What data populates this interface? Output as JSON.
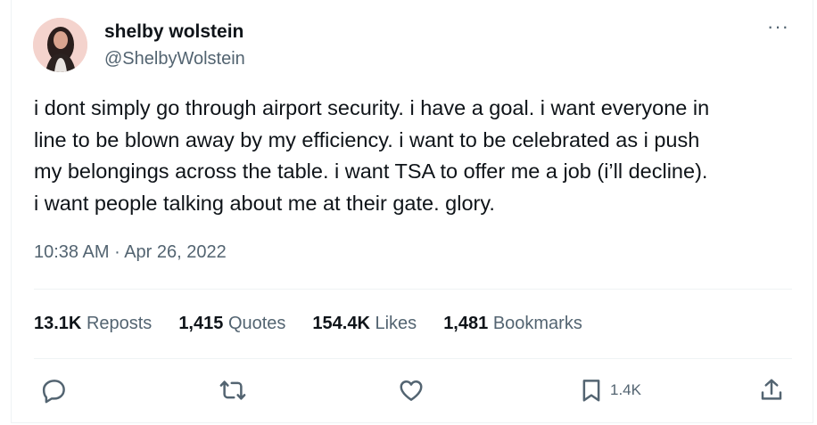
{
  "author": {
    "name": "shelby wolstein",
    "handle": "@ShelbyWolstein"
  },
  "more_label": "···",
  "tweet": {
    "text": "i dont simply go through airport security. i have a goal. i want everyone in\nline to be blown away by my efficiency. i want to be celebrated as i push\nmy belongings across the table. i want TSA to offer me a job (i’ll decline).\ni want people talking about me at their gate. glory.",
    "time": "10:38 AM",
    "separator": " · ",
    "date": "Apr 26, 2022"
  },
  "stats": {
    "reposts_count": "13.1K",
    "reposts_label": "Reposts",
    "quotes_count": "1,415",
    "quotes_label": "Quotes",
    "likes_count": "154.4K",
    "likes_label": "Likes",
    "bookmarks_count": "1,481",
    "bookmarks_label": "Bookmarks"
  },
  "actions": {
    "reply_icon": "reply-icon",
    "repost_icon": "repost-icon",
    "like_icon": "heart-icon",
    "bookmark_icon": "bookmark-icon",
    "bookmark_count": "1.4K",
    "share_icon": "share-icon"
  },
  "colors": {
    "text": "#0f1419",
    "secondary": "#536471",
    "divider": "#eff3f4"
  }
}
